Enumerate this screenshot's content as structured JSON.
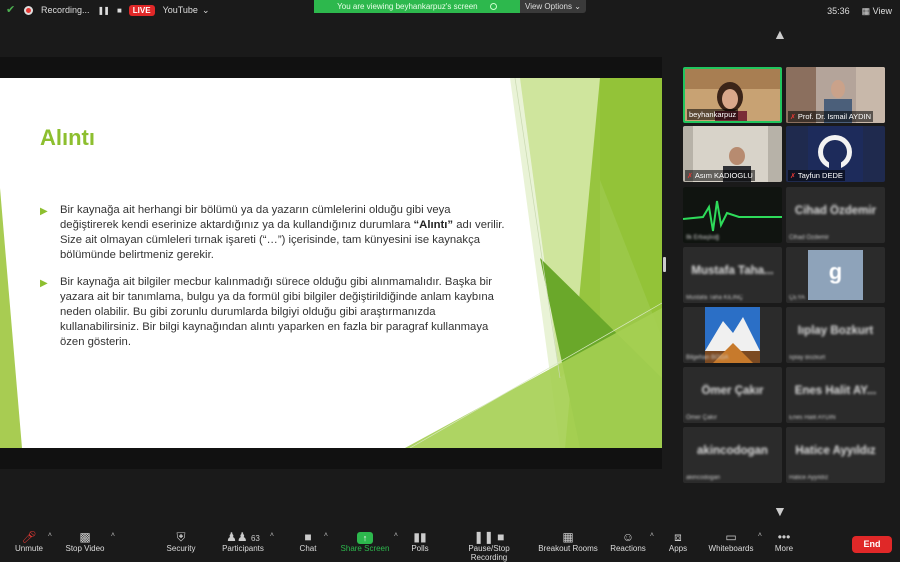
{
  "topbar": {
    "recording_label": "Recording...",
    "live_badge": "LIVE",
    "stream_target": "YouTube",
    "banner_text": "You are viewing beyhankarpuz's screen",
    "view_options_label": "View Options",
    "clock": "35:36",
    "view_label": "View"
  },
  "slide": {
    "title": "Alıntı",
    "bullet1_pre": "Bir kaynağa ait herhangi bir bölümü ya da yazarın cümlelerini olduğu gibi veya değiştirerek kendi eserinize aktardığınız ya da kullandığınız durumlara ",
    "bullet1_bold": "“Alıntı”",
    "bullet1_post": " adı verilir. Size ait olmayan cümleleri tırnak işareti (“…”) içerisinde, tam künyesini ise kaynakça bölümünde belirtmeniz gerekir.",
    "bullet2": "Bir kaynağa ait bilgiler mecbur kalınmadığı sürece olduğu gibi alınmamalıdır. Başka bir yazara ait bir tanımlama, bulgu ya da formül gibi bilgiler değiştirildiğinde anlam kaybına neden olabilir. Bu gibi zorunlu durumlarda bilgiyi olduğu gibi araştırmanızda kullanabilirsiniz. Bir bilgi kaynağından alıntı yaparken en fazla bir paragraf kullanmaya özen gösterin."
  },
  "participants": [
    {
      "name": "beyhankarpuz",
      "sub": ""
    },
    {
      "name": "Prof. Dr. Ismail AYDIN",
      "sub": ""
    },
    {
      "name": "Asım KADIOGLU",
      "sub": ""
    },
    {
      "name": "Tayfun DEDE",
      "sub": ""
    },
    {
      "name": "İlk Erbaşlıoğ",
      "sub": ""
    },
    {
      "name": "Cihad Özdemir",
      "sub": "Cihad Özdemir"
    },
    {
      "name": "Mustafa Taha...",
      "sub": "Mustafa Taha KILINÇ"
    },
    {
      "name": "g",
      "sub": "ÇEYA"
    },
    {
      "name": "Bilgehan BOĞA",
      "sub": ""
    },
    {
      "name": "Iıplay Bozkurt",
      "sub": "Iıplay Bozkurt"
    },
    {
      "name": "Ömer Çakır",
      "sub": "Ömer Çakır"
    },
    {
      "name": "Enes Halit AY...",
      "sub": "Enes Halit AYDIN"
    },
    {
      "name": "akincodogan",
      "sub": "akincodogan"
    },
    {
      "name": "Hatice Ayyıldız",
      "sub": "Hatice Ayyıldız"
    }
  ],
  "toolbar": {
    "unmute": "Unmute",
    "stop_video": "Stop Video",
    "security": "Security",
    "participants": "Participants",
    "participant_count": "63",
    "chat": "Chat",
    "share_screen": "Share Screen",
    "polls": "Polls",
    "pause_recording": "Pause/Stop Recording",
    "breakout": "Breakout Rooms",
    "reactions": "Reactions",
    "apps": "Apps",
    "whiteboards": "Whiteboards",
    "more": "More",
    "end": "End"
  },
  "colors": {
    "accent_green": "#8dbf2f",
    "share_green": "#2db84d",
    "end_red": "#e02828",
    "active_border": "#22c55e"
  }
}
